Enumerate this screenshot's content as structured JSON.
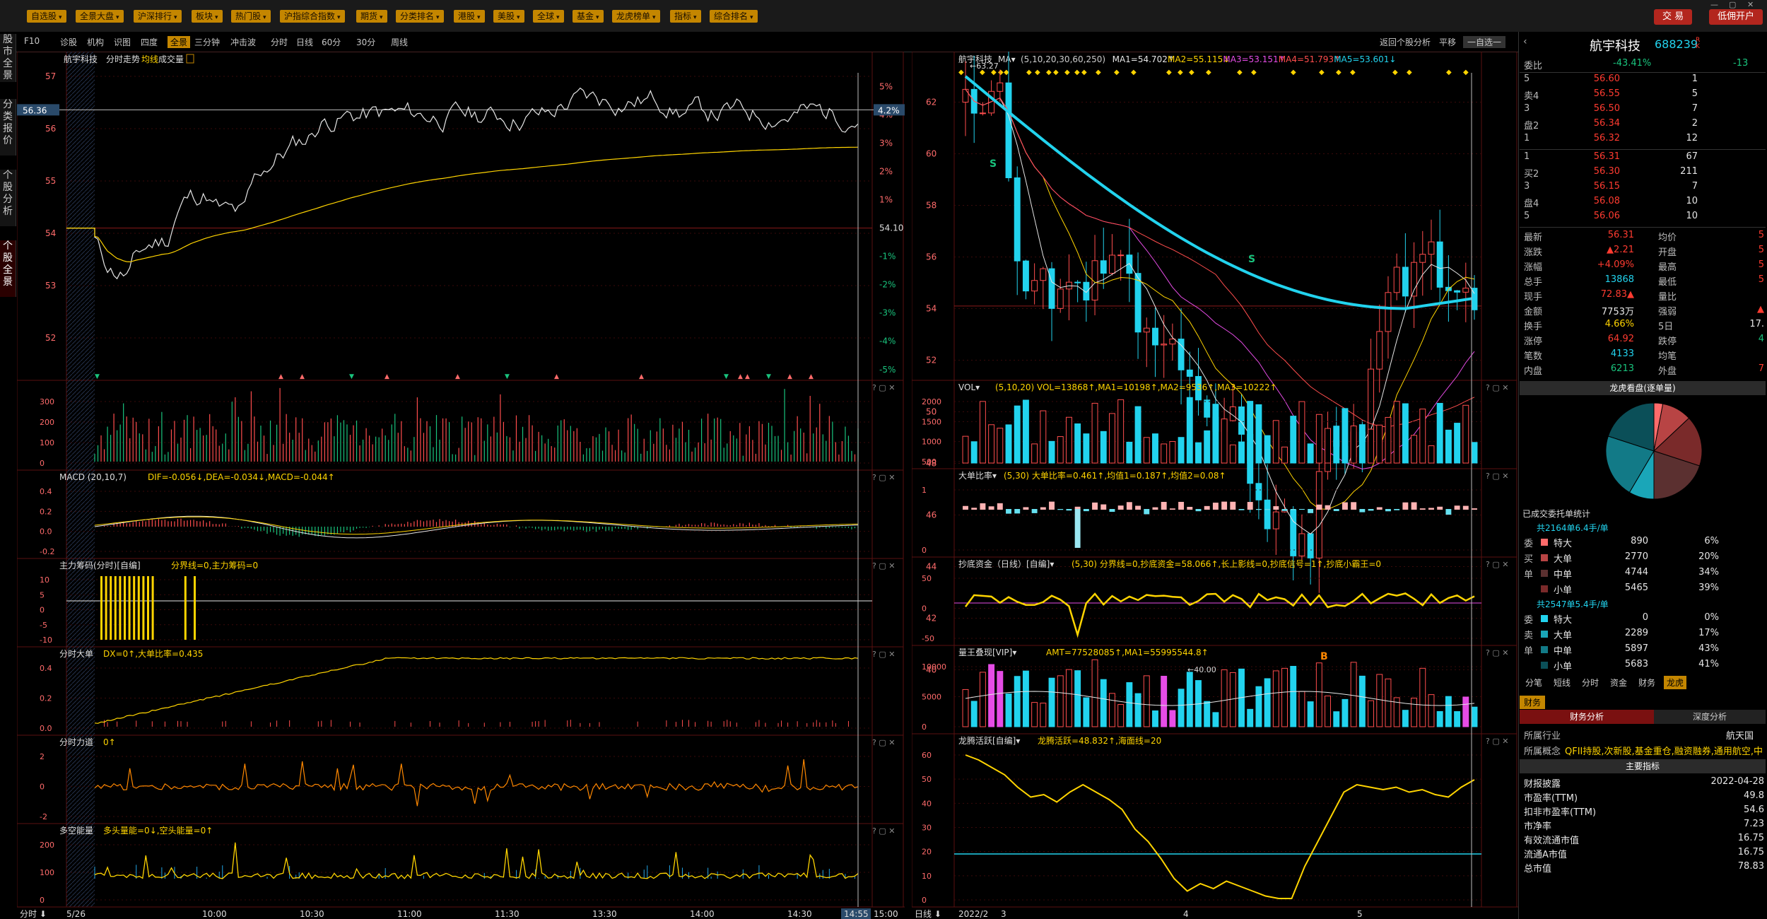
{
  "top_bar": {
    "menus": [
      "自选股",
      "全景大盘",
      "沪深排行",
      "板块",
      "热门股",
      "沪指综合指数",
      "期货",
      "分类排名",
      "港股",
      "美股",
      "全球",
      "基金",
      "龙虎榜单",
      "指标",
      "综合排名"
    ],
    "trade_btn": "交 易",
    "open_btn": "低佣开户",
    "window_controls": [
      "—",
      "▢",
      "✕"
    ]
  },
  "sub_bar": {
    "left_items": [
      "F10",
      "诊股",
      "机构",
      "识图",
      "四度",
      "全景",
      "三分钟",
      "冲击波"
    ],
    "selected": "全景",
    "period_items": [
      "分时",
      "日线",
      "60分",
      "30分",
      "周线"
    ],
    "right_items": [
      "返回个股分析",
      "平移",
      "一自选一"
    ]
  },
  "left_tabs": [
    "股市全景",
    "分类报价",
    "个股分析",
    "个股全景"
  ],
  "intraday": {
    "title": "航宇科技",
    "title2": "分时走势",
    "avg_label": "均线",
    "vol_label": "成交量",
    "price_ticks": [
      "57",
      "56",
      "55",
      "54",
      "53",
      "52"
    ],
    "current_price_tag": "56.36",
    "pct_ticks": [
      "5%",
      "4%",
      "3%",
      "2%",
      "1%",
      "54.10",
      "-1%",
      "-2%",
      "-3%",
      "-4%",
      "-5%"
    ],
    "current_pct_tag": "4.2%",
    "time_axis": [
      "5/26",
      "10:00",
      "10:30",
      "11:00",
      "11:30",
      "13:30",
      "14:00",
      "14:30",
      "14:55",
      "15:00"
    ],
    "axis_switch": "分时"
  },
  "left_sub_panels": [
    {
      "label": "",
      "ticks": [
        "300",
        "200",
        "100",
        "0"
      ]
    },
    {
      "label": "MACD",
      "params": "(20,10,7)",
      "values": "DIF=-0.056↓,DEA=-0.034↓,MACD=-0.044↑",
      "ticks": [
        "0.4",
        "0.2",
        "0.0",
        "-0.2"
      ]
    },
    {
      "label": "主力筹码(分时)[自编]",
      "params": "",
      "values": "分界线=0,主力筹码=0",
      "ticks": [
        "10",
        "5",
        "0",
        "-5",
        "-10"
      ]
    },
    {
      "label": "分时大单",
      "params": "",
      "values": "DX=0↑,大单比率=0.435",
      "ticks": [
        "0.4",
        "0.2",
        "0.0"
      ]
    },
    {
      "label": "分时力道",
      "params": "",
      "values": "0↑",
      "ticks": [
        "2",
        "0",
        "-2"
      ]
    },
    {
      "label": "多空能量",
      "params": "",
      "values": "多头量能=0↓,空头能量=0↑",
      "ticks": [
        "200",
        "100",
        "0"
      ]
    }
  ],
  "kline": {
    "title": "航宇科技",
    "ma_label": "MA",
    "ma_values": [
      {
        "text": "(5,10,20,30,60,250)",
        "color": "#cccccc"
      },
      {
        "text": "MA1=54.702↑",
        "color": "#e6e6e6"
      },
      {
        "text": "MA2=55.115↓",
        "color": "#ffd400"
      },
      {
        "text": "MA3=53.151↑",
        "color": "#e64ce6"
      },
      {
        "text": "MA4=51.793↑",
        "color": "#ff4d4d"
      },
      {
        "text": "MA5=53.601↓",
        "color": "#22d3ee"
      }
    ],
    "price_ticks": [
      "62",
      "60",
      "58",
      "56",
      "54",
      "52",
      "50",
      "48",
      "46",
      "44",
      "42",
      "40"
    ],
    "high_mark": "63.27",
    "low_mark": "40.00",
    "signal_b": "B",
    "signal_s": "S",
    "date_axis": [
      "2022/2",
      "3",
      "4",
      "5"
    ],
    "axis_switch": "日线"
  },
  "right_sub_panels": [
    {
      "label": "VOL",
      "values": "(5,10,20)  VOL=13868↑,MA1=10198↑,MA2=9536↑,MA3=10222↑",
      "ticks": [
        "2000",
        "1500",
        "1000",
        "500"
      ]
    },
    {
      "label": "大单比率",
      "values": "(5,30)  大单比率=0.461↑,均值1=0.187↑,均值2=0.08↑",
      "ticks": [
        "1",
        "0"
      ]
    },
    {
      "label": "抄底资金（日线）[自编]",
      "values": "(5,30)  分界线=0,抄底资金=58.066↑,长上影线=0,抄底信号=1↑,抄底小霸王=0",
      "ticks": [
        "50",
        "0",
        "-50"
      ]
    },
    {
      "label": "量王叠现[VIP]",
      "values": "AMT=77528085↑,MA1=55995544.8↑",
      "ticks": [
        "10000",
        "5000",
        "0"
      ]
    },
    {
      "label": "龙腾活跃[自编]",
      "values": "龙腾活跃=48.832↑,海面线=20",
      "ticks": [
        "60",
        "50",
        "40",
        "30",
        "20",
        "10",
        "0"
      ]
    }
  ],
  "quote": {
    "stock_name": "航宇科技",
    "stock_code": "688239",
    "rz": "R K",
    "weibi_label": "委比",
    "weibi_value": "-43.41%",
    "weibi_diff": "-13",
    "asks": [
      {
        "label": "5",
        "price": "56.60",
        "vol": "1"
      },
      {
        "label": "卖4",
        "price": "56.55",
        "vol": "5"
      },
      {
        "label": "3",
        "price": "56.50",
        "vol": "7"
      },
      {
        "label": "盘2",
        "price": "56.34",
        "vol": "2"
      },
      {
        "label": "1",
        "price": "56.32",
        "vol": "12"
      }
    ],
    "bids": [
      {
        "label": "1",
        "price": "56.31",
        "vol": "67"
      },
      {
        "label": "买2",
        "price": "56.30",
        "vol": "211"
      },
      {
        "label": "3",
        "price": "56.15",
        "vol": "7"
      },
      {
        "label": "盘4",
        "price": "56.08",
        "vol": "10"
      },
      {
        "label": "5",
        "price": "56.06",
        "vol": "10"
      }
    ],
    "stats": [
      {
        "l1": "最新",
        "v1": "56.31",
        "c1": "red",
        "l2": "均价",
        "v2": "5",
        "c2": "red"
      },
      {
        "l1": "涨跌",
        "v1": "▲2.21",
        "c1": "red",
        "l2": "开盘",
        "v2": "5",
        "c2": "red"
      },
      {
        "l1": "涨幅",
        "v1": "+4.09%",
        "c1": "red",
        "l2": "最高",
        "v2": "5",
        "c2": "red"
      },
      {
        "l1": "总手",
        "v1": "13868",
        "c1": "cyan",
        "l2": "最低",
        "v2": "5",
        "c2": "red"
      },
      {
        "l1": "现手",
        "v1": "72.83▲",
        "c1": "red",
        "l2": "量比",
        "v2": "",
        "c2": "wht"
      },
      {
        "l1": "金额",
        "v1": "7753万",
        "c1": "wht",
        "l2": "强弱",
        "v2": "▲",
        "c2": "red"
      },
      {
        "l1": "换手",
        "v1": "4.66%",
        "c1": "yel",
        "l2": "5日",
        "v2": "17.",
        "c2": "wht"
      },
      {
        "l1": "涨停",
        "v1": "64.92",
        "c1": "red",
        "l2": "跌停",
        "v2": "4",
        "c2": "grn"
      },
      {
        "l1": "笔数",
        "v1": "4133",
        "c1": "cyan",
        "l2": "均笔",
        "v2": "",
        "c2": "wht"
      },
      {
        "l1": "内盘",
        "v1": "6213",
        "c1": "grn",
        "l2": "外盘",
        "v2": "7",
        "c2": "red"
      }
    ],
    "pie_title": "龙虎看盘(逐单量)",
    "pie_data": [
      0.06,
      0.2,
      0.34,
      0.39
    ],
    "pie_colors": [
      "#ff6b6b",
      "#b84444",
      "#5b3030",
      "#2d7f7f"
    ],
    "deal_title": "已成交委托单统计",
    "buy_total": "共2164单6.4手/单",
    "buy_rows": [
      {
        "side": "委",
        "name": "特大",
        "count": "890",
        "pct": "6%",
        "color": "#ff6b6b"
      },
      {
        "side": "买",
        "name": "大单",
        "count": "2770",
        "pct": "20%",
        "color": "#b84444"
      },
      {
        "side": "单",
        "name": "中单",
        "count": "4744",
        "pct": "34%",
        "color": "#5b3030"
      },
      {
        "side": "",
        "name": "小单",
        "count": "5465",
        "pct": "39%",
        "color": "#7a2a2a"
      }
    ],
    "sell_total": "共2547单5.4手/单",
    "sell_rows": [
      {
        "side": "委",
        "name": "特大",
        "count": "0",
        "pct": "0%",
        "color": "#22d3ee"
      },
      {
        "side": "卖",
        "name": "大单",
        "count": "2289",
        "pct": "17%",
        "color": "#1aa6b8"
      },
      {
        "side": "单",
        "name": "中单",
        "count": "5897",
        "pct": "43%",
        "color": "#127a87"
      },
      {
        "side": "",
        "name": "小单",
        "count": "5683",
        "pct": "41%",
        "color": "#0b4f58"
      }
    ],
    "tabs": [
      "分笔",
      "短线",
      "分时",
      "资金",
      "财务",
      "龙虎"
    ],
    "active_tab": "龙虎",
    "finance_tab": "财务",
    "fin_tabs": [
      "财务分析",
      "深度分析"
    ],
    "industry_label": "所属行业",
    "industry_value": "航天国",
    "concept_label": "所属概念",
    "concept_value": "QFII持股,次新股,基金重仓,融资融券,通用航空,中",
    "main_index": "主要指标",
    "fin_rows": [
      {
        "label": "财报披露",
        "value": "2022-04-28"
      },
      {
        "label": "市盈率(TTM)",
        "value": "49.8"
      },
      {
        "label": "扣非市盈率(TTM)",
        "value": "54.6"
      },
      {
        "label": "市净率",
        "value": "7.23"
      },
      {
        "label": "有效流通市值",
        "value": "16.75"
      },
      {
        "label": "流通A市值",
        "value": "16.75"
      },
      {
        "label": "总市值",
        "value": "78.83"
      }
    ]
  },
  "colors": {
    "up": "#ff3b30",
    "down": "#19c37d",
    "cyan": "#22d3ee",
    "yellow": "#ffd400",
    "magenta": "#e64ce6",
    "orange": "#c48600"
  }
}
